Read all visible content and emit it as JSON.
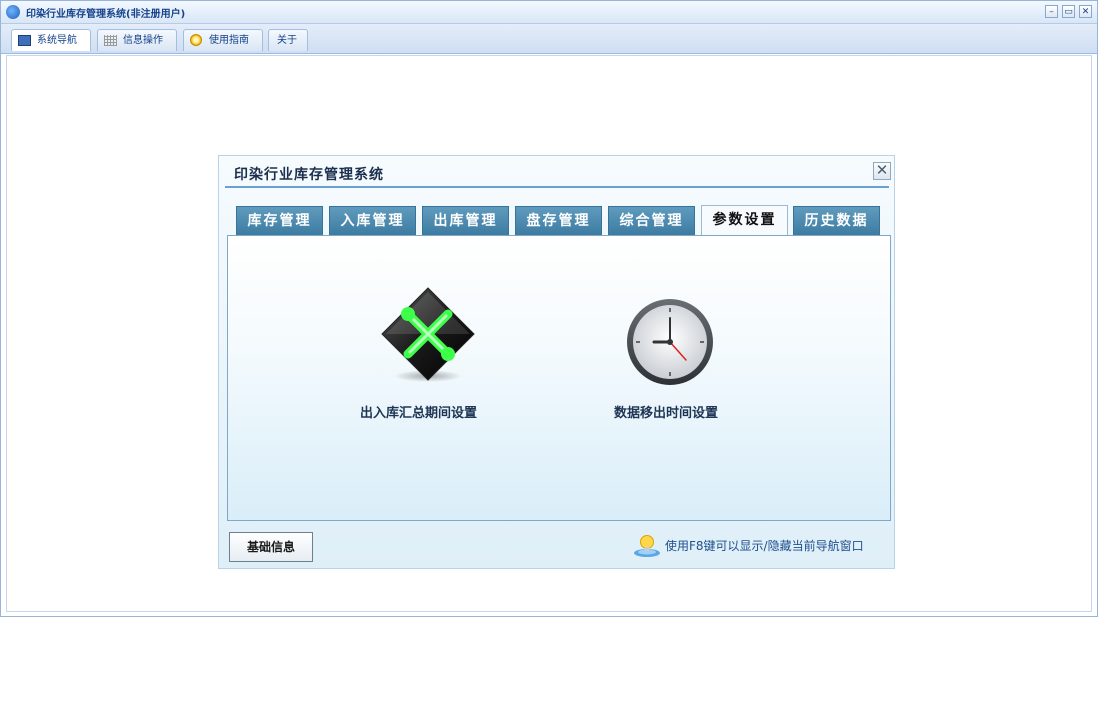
{
  "window": {
    "title": "印染行业库存管理系统(非注册用户)",
    "controls": [
      "minimize-icon",
      "restore-icon",
      "close-icon"
    ],
    "minimize_glyph": "–",
    "restore_glyph": "▭",
    "close_glyph": "✕"
  },
  "top_tabs": [
    {
      "label": "系统导航",
      "icon": "nav-icon",
      "active": true
    },
    {
      "label": "信息操作",
      "icon": "grid-icon",
      "active": false
    },
    {
      "label": "使用指南",
      "icon": "help-icon",
      "active": false
    },
    {
      "label": "关于",
      "icon": "",
      "active": false
    }
  ],
  "dialog": {
    "title": "印染行业库存管理系统",
    "close_glyph": "✕",
    "tabs": [
      {
        "label": "库存管理",
        "active": false
      },
      {
        "label": "入库管理",
        "active": false
      },
      {
        "label": "出库管理",
        "active": false
      },
      {
        "label": "盘存管理",
        "active": false
      },
      {
        "label": "综合管理",
        "active": false
      },
      {
        "label": "参数设置",
        "active": true
      },
      {
        "label": "历史数据",
        "active": false
      }
    ],
    "items": [
      {
        "label": "出入库汇总期间设置",
        "icon": "tools-icon"
      },
      {
        "label": "数据移出时间设置",
        "icon": "clock-icon"
      }
    ],
    "footer": {
      "button_label": "基础信息",
      "hint": "使用F8键可以显示/隐藏当前导航窗口",
      "hint_icon": "lightbulb-icon"
    }
  },
  "colors": {
    "accent": "#15428b",
    "tab_bg": "#4a87ad",
    "tool_green": "#3cff4a"
  }
}
